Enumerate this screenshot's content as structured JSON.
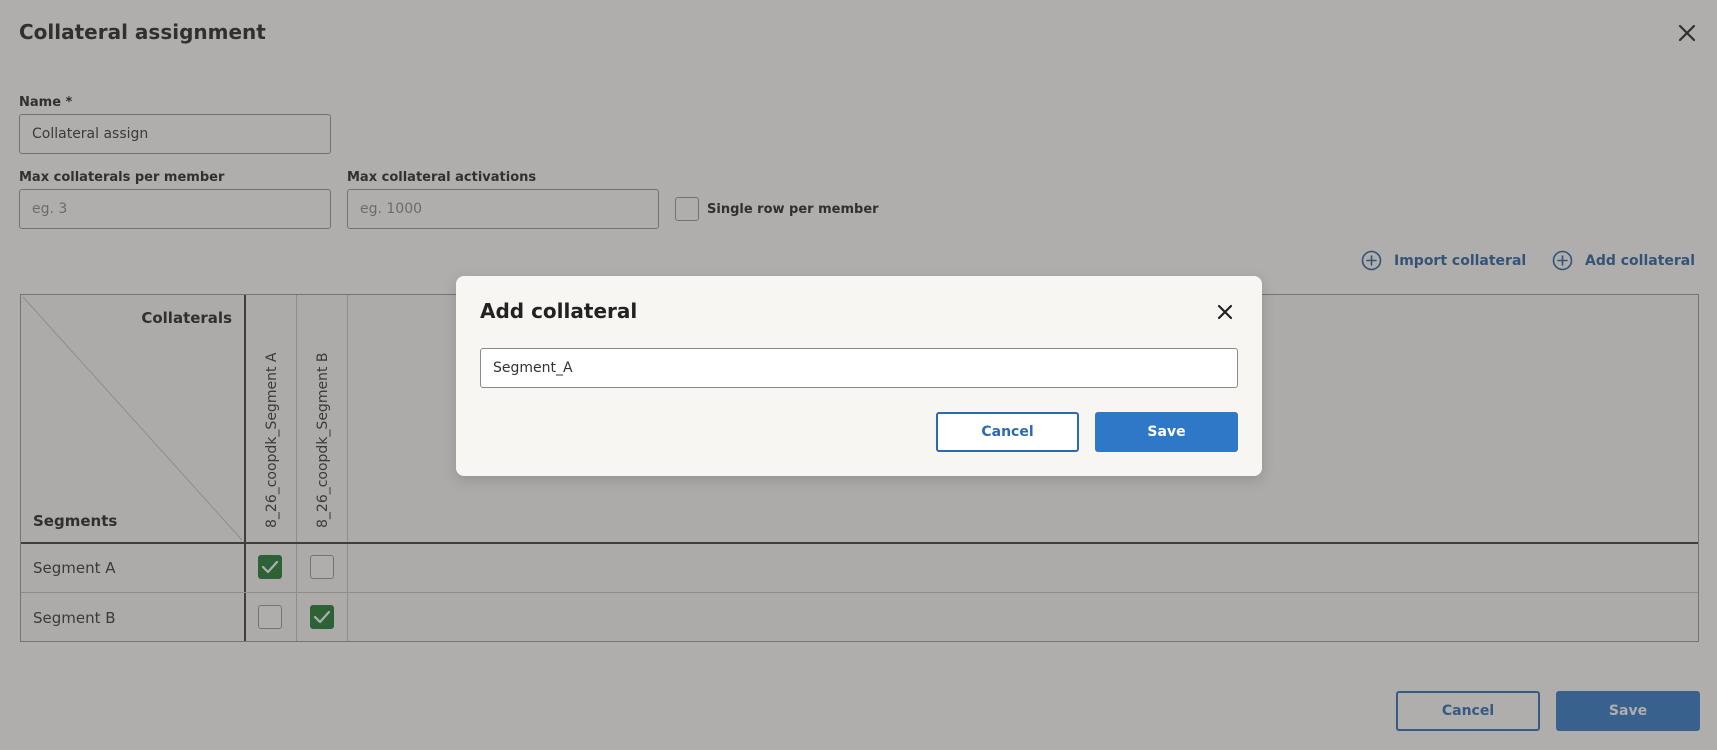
{
  "page": {
    "title": "Collateral assignment",
    "name_label": "Name *",
    "name_value": "Collateral assign",
    "max_collaterals_label": "Max collaterals per member",
    "max_collaterals_placeholder": "eg. 3",
    "max_activations_label": "Max collateral activations",
    "max_activations_placeholder": "eg. 1000",
    "single_row_label": "Single row per member",
    "single_row_checked": false,
    "import_label": "Import collateral",
    "add_label": "Add collateral",
    "cancel_label": "Cancel",
    "save_label": "Save"
  },
  "matrix": {
    "corner_top": "Collaterals",
    "corner_bottom": "Segments",
    "columns": [
      "8_26_coopdk_Segment A",
      "8_26_coopdk_Segment B"
    ],
    "rows": [
      {
        "label": "Segment A",
        "checks": [
          true,
          false
        ]
      },
      {
        "label": "Segment B",
        "checks": [
          false,
          true
        ]
      }
    ]
  },
  "modal": {
    "title": "Add collateral",
    "input_value": "Segment_A",
    "cancel_label": "Cancel",
    "save_label": "Save"
  },
  "icons": {
    "close": "close-icon",
    "plus_circle": "plus-circle-icon",
    "check": "checkmark-icon"
  },
  "colors": {
    "primary": "#2f78c8",
    "link": "#2a5fa0",
    "checked": "#1a7a2e"
  }
}
